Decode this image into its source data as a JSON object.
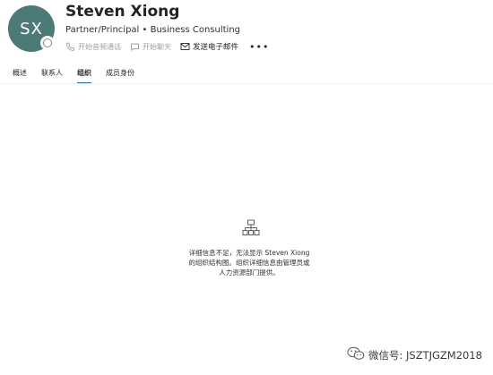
{
  "profile": {
    "initials": "SX",
    "name": "Steven Xiong",
    "title": "Partner/Principal • Business Consulting"
  },
  "actions": {
    "call": "开始音频通话",
    "chat": "开始聊天",
    "email": "发送电子邮件",
    "more": "•••"
  },
  "tabs": [
    "概述",
    "联系人",
    "组织",
    "成员身份"
  ],
  "active_tab": "组织",
  "empty_state": {
    "icon": "org-chart-icon",
    "message_line1": "详细信息不足，无法显示 Steven Xiong",
    "message_line2": "的组织结构图。组织详细信息由管理员或",
    "message_line3": "人力资源部门提供。"
  },
  "watermark": {
    "icon": "wechat-icon",
    "text": "微信号: JSZTJGZM2018"
  }
}
